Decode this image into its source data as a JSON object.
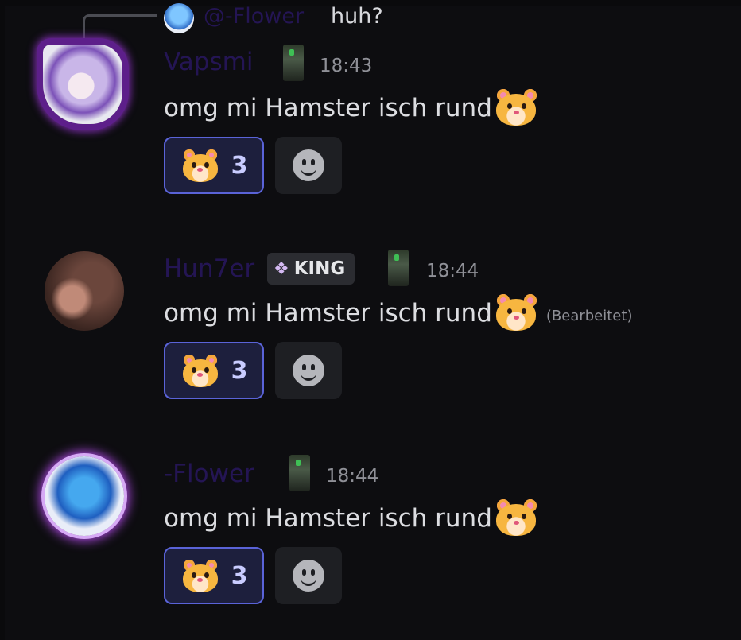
{
  "reply": {
    "name": "@-Flower",
    "text": "huh?"
  },
  "messages": [
    {
      "username": "Vapsmi",
      "time": "18:43",
      "text": "omg mi Hamster isch rund",
      "reaction_count": "3"
    },
    {
      "username": "Hun7er",
      "tag": "KING",
      "time": "18:44",
      "text": "omg mi Hamster isch rund",
      "edited": "(Bearbeitet)",
      "reaction_count": "3"
    },
    {
      "username": "-Flower",
      "time": "18:44",
      "text": "omg mi Hamster isch rund",
      "reaction_count": "3"
    }
  ],
  "icons": {
    "reaction_emoji": "hamster-icon",
    "add_reaction": "smiley-icon",
    "tag_icon": "diamond-icon"
  },
  "colors": {
    "username": "#241554",
    "reaction_border": "#5a63d8",
    "reaction_bg": "#1d1f3d",
    "background": "#0d0d10"
  }
}
